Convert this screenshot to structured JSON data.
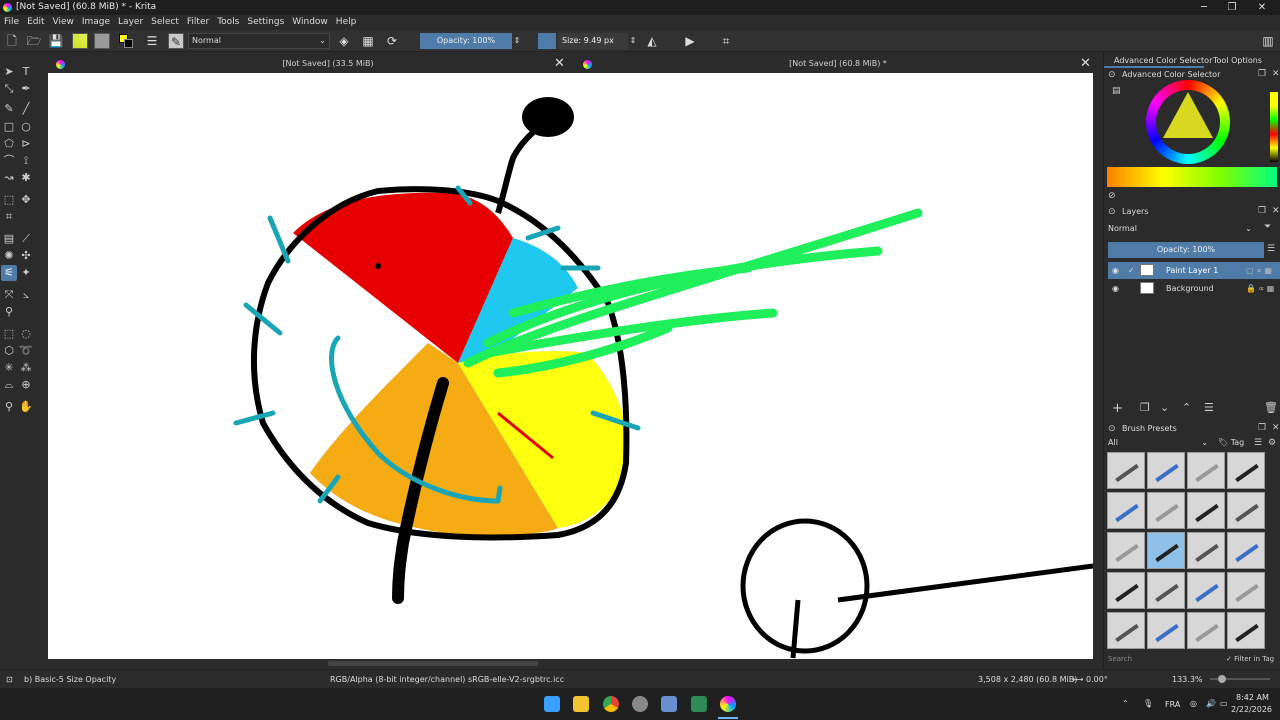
{
  "window": {
    "title": "[Not Saved]  (60.8 MiB) * - Krita",
    "minimize": "─",
    "restore": "❐",
    "close": "✕"
  },
  "menu": [
    "File",
    "Edit",
    "View",
    "Image",
    "Layer",
    "Select",
    "Filter",
    "Tools",
    "Settings",
    "Window",
    "Help"
  ],
  "toolbar": {
    "blend_mode": "Normal",
    "opacity": "Opacity: 100%",
    "size": "Size: 9.49 px"
  },
  "tabs": [
    {
      "label": "[Not Saved]  (33.5 MiB)"
    },
    {
      "label": "[Not Saved]  (60.8 MiB) *"
    }
  ],
  "dock": {
    "tab_advanced_color": "Advanced Color Selector",
    "tab_tool_options": "Tool Options",
    "color_panel_title": "Advanced Color Selector",
    "layers_title": "Layers",
    "layers_blend": "Normal",
    "layers_opacity": "Opacity:  100%",
    "layers": [
      {
        "name": "Paint Layer 1",
        "selected": true
      },
      {
        "name": "Background",
        "selected": false
      }
    ],
    "brush_presets_title": "Brush Presets",
    "brush_filter": "All",
    "brush_tag": "Tag",
    "search_placeholder": "Search",
    "filter_in_tag": "Filter in Tag"
  },
  "status": {
    "brush": "b) Basic-5 Size Opacity",
    "color_space": "RGB/Alpha (8-bit integer/channel)  sRGB-elle-V2-srgbtrc.icc",
    "dimensions": "3,508 x 2,480 (60.8 MiB)",
    "rotation": "0.00°",
    "zoom": "133.3%"
  },
  "taskbar": {
    "lang": "FRA",
    "time": "8:42 AM",
    "date": "2/22/2026"
  },
  "colors": {
    "accent": "#4f7ba8",
    "red": "#e60000",
    "cyan": "#1ec8ee",
    "orange": "#f5ab14",
    "yellow": "#ffff10",
    "green": "#1eef5a",
    "teal": "#1aa5b6"
  }
}
